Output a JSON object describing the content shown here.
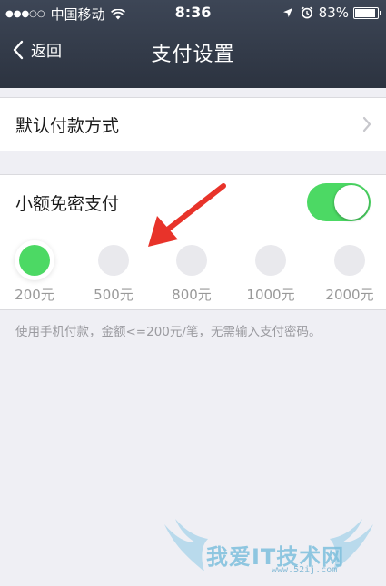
{
  "status_bar": {
    "signal_dots": "●●●○○",
    "carrier": "中国移动",
    "time": "8:36",
    "battery": "83%",
    "battery_level": 0.83
  },
  "nav": {
    "back_label": "返回",
    "title": "支付设置"
  },
  "default_payment": {
    "label": "默认付款方式"
  },
  "small_amount": {
    "label": "小额免密支付",
    "enabled": true
  },
  "amount_options": [
    {
      "label": "200元",
      "selected": true
    },
    {
      "label": "500元",
      "selected": false
    },
    {
      "label": "800元",
      "selected": false
    },
    {
      "label": "1000元",
      "selected": false
    },
    {
      "label": "2000元",
      "selected": false
    }
  ],
  "note": "使用手机付款，金额<=200元/笔，无需输入支付密码。",
  "watermark": {
    "text": "我爱IT技术网",
    "url": "www.52ij.com"
  },
  "colors": {
    "accent_green": "#4cd964",
    "nav_bg": "#2f3643",
    "annotation_arrow": "#e8332a"
  }
}
